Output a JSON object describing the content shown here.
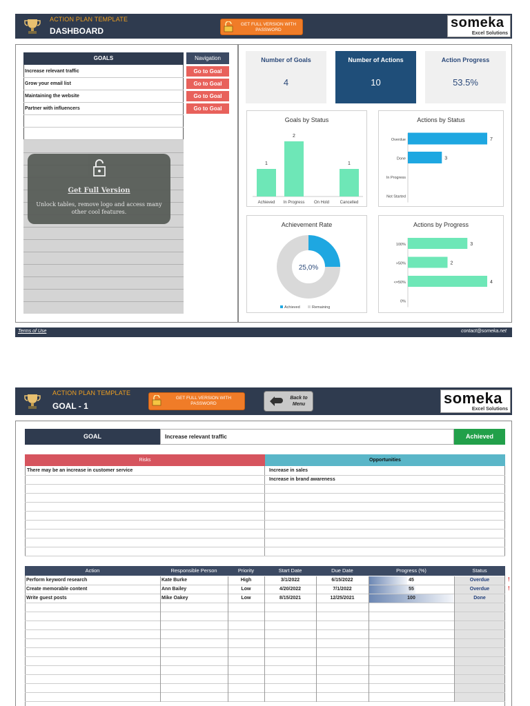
{
  "dashboard": {
    "header": {
      "title": "ACTION PLAN TEMPLATE",
      "subtitle": "DASHBOARD",
      "promo": "GET FULL VERSION WITH PASSWORD"
    },
    "logo": {
      "main": "someka",
      "sub": "Excel Solutions"
    },
    "goals_header": "GOALS",
    "goals": [
      "Increase relevant traffic",
      "Grow your email list",
      "Maintaining the website",
      "Partner with influencers"
    ],
    "nav_header": "Navigation",
    "nav_button": "Go to Goal",
    "overlay": {
      "title": "Get Full Version",
      "message": "Unlock tables, remove logo and access many other cool features."
    },
    "kpis": [
      {
        "label": "Number of Goals",
        "value": "4"
      },
      {
        "label": "Number of Actions",
        "value": "10"
      },
      {
        "label": "Action Progress",
        "value": "53.5%"
      }
    ],
    "footer": {
      "left": "Terms of Use",
      "right": "contact@someka.net"
    }
  },
  "goal_page": {
    "header": {
      "title": "ACTION PLAN TEMPLATE",
      "subtitle": "GOAL - 1",
      "promo": "GET FULL VERSION WITH PASSWORD",
      "back": "Back to Menu"
    },
    "logo": {
      "main": "someka",
      "sub": "Excel Solutions"
    },
    "goal_label": "GOAL",
    "goal_value": "Increase relevant traffic",
    "goal_status": "Achieved",
    "risks_header": "Risks",
    "opportunities_header": "Opportunities",
    "risks": [
      "There may be an increase in customer service"
    ],
    "opportunities": [
      "Increase in sales",
      "Increase in brand awareness"
    ],
    "action_columns": [
      "Action",
      "Responsible Person",
      "Priority",
      "Start Date",
      "Due Date",
      "Progress (%)",
      "Status"
    ],
    "actions": [
      {
        "action": "Perform keyword research",
        "person": "Kate Burke",
        "priority": "High",
        "start": "3/1/2022",
        "due": "6/15/2022",
        "progress": "45",
        "status": "Overdue",
        "flag": "!"
      },
      {
        "action": "Create memorable content",
        "person": "Ann Bailey",
        "priority": "Low",
        "start": "4/20/2022",
        "due": "7/1/2022",
        "progress": "55",
        "status": "Overdue",
        "flag": "!"
      },
      {
        "action": "Write guest posts",
        "person": "Mike Oakey",
        "priority": "Low",
        "start": "8/15/2021",
        "due": "12/25/2021",
        "progress": "100",
        "status": "Done",
        "flag": ""
      }
    ]
  },
  "colors": {
    "navy": "#2f3b4f",
    "orange": "#f07c28",
    "teal": "#6ee7b7",
    "blue": "#1ea7e1",
    "red": "#e8615b",
    "green": "#22a04a"
  },
  "chart_data": [
    {
      "type": "bar",
      "title": "Goals by Status",
      "categories": [
        "Achieved",
        "In Progress",
        "On Hold",
        "Cancelled"
      ],
      "values": [
        1,
        2,
        0,
        1
      ],
      "color": "#6ee7b7"
    },
    {
      "type": "bar",
      "orientation": "horizontal",
      "title": "Actions by Status",
      "categories": [
        "Overdue",
        "Done",
        "In Progress",
        "Not Started"
      ],
      "values": [
        7,
        3,
        0,
        0
      ],
      "color": "#1ea7e1"
    },
    {
      "type": "pie",
      "donut": true,
      "title": "Achievement Rate",
      "center_label": "25,0%",
      "categories": [
        "Achieved",
        "Remaining"
      ],
      "values": [
        25,
        75
      ],
      "colors": [
        "#1ea7e1",
        "#d9d9d9"
      ],
      "legend": "bottom"
    },
    {
      "type": "bar",
      "orientation": "horizontal",
      "title": "Actions by Progress",
      "categories": [
        "100%",
        ">50%",
        "<=50%",
        "0%"
      ],
      "values": [
        3,
        2,
        4,
        0
      ],
      "color": "#6ee7b7"
    }
  ]
}
